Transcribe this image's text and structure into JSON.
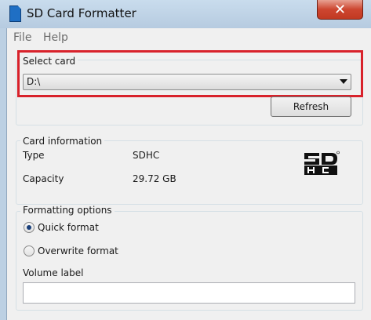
{
  "window": {
    "title": "SD Card Formatter",
    "close_glyph": "✕"
  },
  "menu": {
    "file": "File",
    "help": "Help"
  },
  "select_card": {
    "label": "Select card",
    "selected": "D:\\",
    "refresh_label": "Refresh"
  },
  "card_info": {
    "label": "Card information",
    "type_label": "Type",
    "type_value": "SDHC",
    "capacity_label": "Capacity",
    "capacity_value": "29.72 GB",
    "logo_icon": "sdhc-logo-icon"
  },
  "formatting": {
    "label": "Formatting options",
    "quick_label": "Quick format",
    "overwrite_label": "Overwrite format",
    "selected_option": "Quick format",
    "volume_label_title": "Volume label",
    "volume_label_value": ""
  },
  "colors": {
    "highlight": "#d8222b",
    "close_button": "#c23a22"
  }
}
